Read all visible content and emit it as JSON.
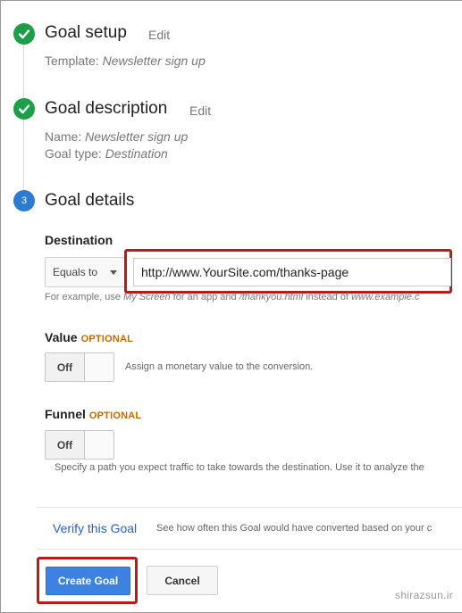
{
  "steps": {
    "setup": {
      "title": "Goal setup",
      "edit_label": "Edit",
      "template_label": "Template:",
      "template_value": "Newsletter sign up"
    },
    "description": {
      "title": "Goal description",
      "edit_label": "Edit",
      "name_label": "Name:",
      "name_value": "Newsletter sign up",
      "type_label": "Goal type:",
      "type_value": "Destination"
    },
    "details": {
      "number": "3",
      "title": "Goal details"
    }
  },
  "destination": {
    "label": "Destination",
    "match_type": "Equals to",
    "url_value": "http://www.YourSite.com/thanks-page",
    "example_prefix": "For example, use ",
    "example_app": "My Screen",
    "example_mid1": " for an app and ",
    "example_page": "/thankyou.html",
    "example_mid2": " instead of ",
    "example_domain": "www.example.c"
  },
  "value": {
    "label": "Value",
    "optional": "OPTIONAL",
    "toggle_state": "Off",
    "hint": "Assign a monetary value to the conversion."
  },
  "funnel": {
    "label": "Funnel",
    "optional": "OPTIONAL",
    "toggle_state": "Off",
    "hint": "Specify a path you expect traffic to take towards the destination. Use it to analyze the"
  },
  "verify": {
    "link": "Verify this Goal",
    "description": "See how often this Goal would have converted based on your c"
  },
  "actions": {
    "create": "Create Goal",
    "cancel": "Cancel"
  },
  "watermark": "shirazsun.ir",
  "colors": {
    "done": "#1e9e48",
    "current": "#2b7bd1",
    "primary": "#3d82e0",
    "highlight": "#b71c1c",
    "optional": "#c06a00",
    "link": "#2a63b8"
  },
  "icons": {
    "done": "checkmark-icon",
    "dropdown": "caret-down-icon"
  }
}
